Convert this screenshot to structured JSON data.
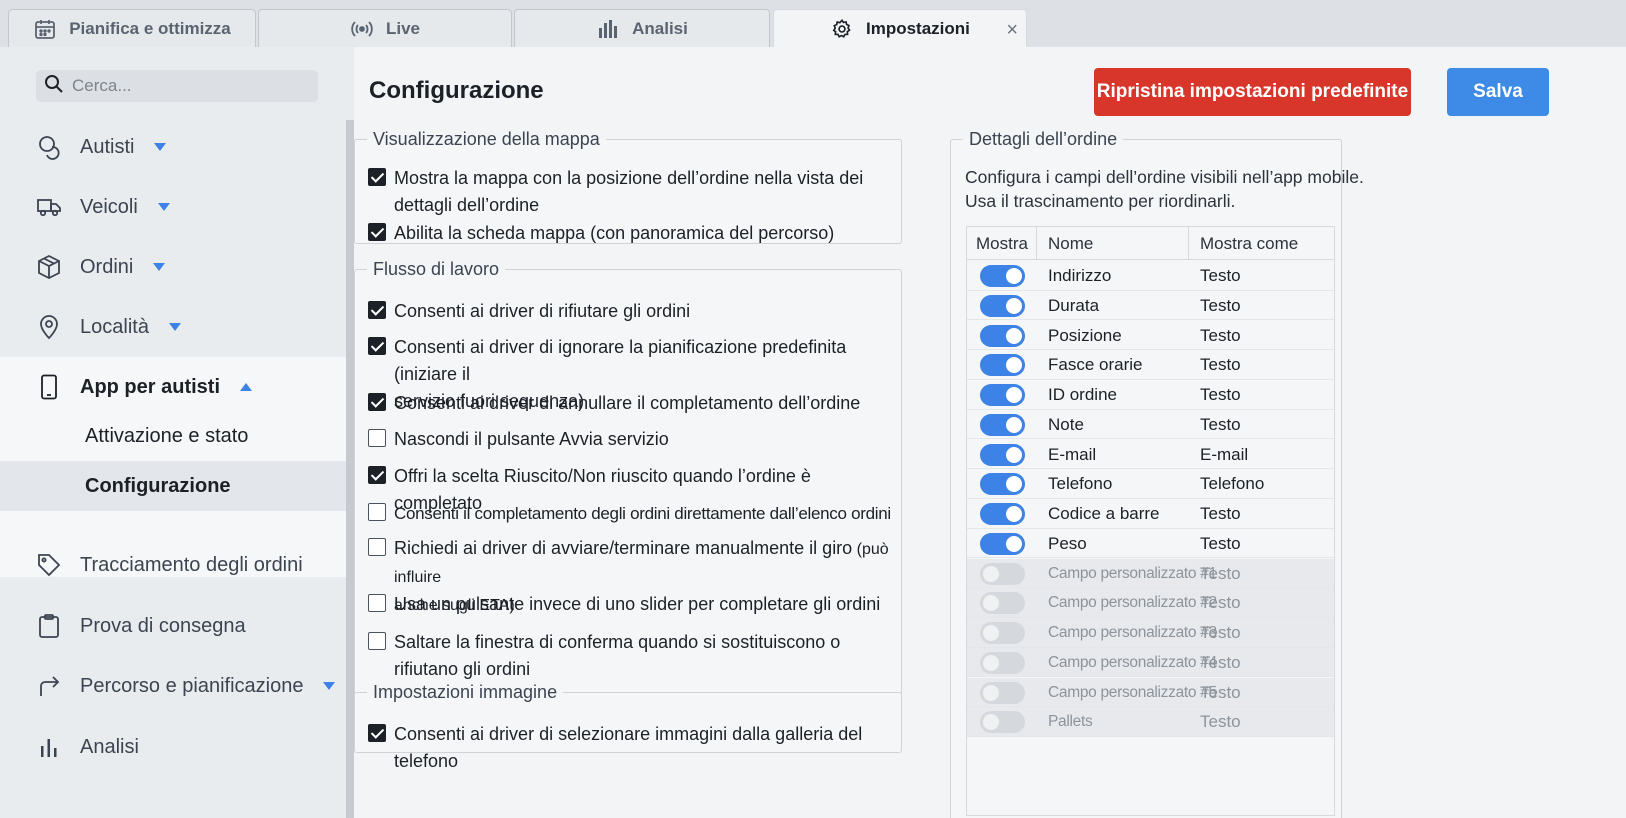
{
  "tabs": [
    {
      "label": "Pianifica e ottimizza",
      "icon": "calendar-icon"
    },
    {
      "label": "Live",
      "icon": "broadcast-icon"
    },
    {
      "label": "Analisi",
      "icon": "bar-chart-icon"
    },
    {
      "label": "Impostazioni",
      "icon": "gear-icon",
      "active": true
    }
  ],
  "tab_close": "×",
  "sidebar": {
    "search_placeholder": "Cerca...",
    "items": [
      {
        "label": "Autisti",
        "icon": "users-icon"
      },
      {
        "label": "Veicoli",
        "icon": "truck-icon"
      },
      {
        "label": "Ordini",
        "icon": "box-icon"
      },
      {
        "label": "Località",
        "icon": "location-pin-icon"
      },
      {
        "label": "App per autisti",
        "icon": "mobile-icon"
      },
      {
        "label": "Tracciamento degli ordini",
        "icon": "tag-icon"
      },
      {
        "label": "Prova di consegna",
        "icon": "clipboard-icon"
      },
      {
        "label": "Percorso e pianificazione",
        "icon": "route-arrow-icon"
      },
      {
        "label": "Analisi",
        "icon": "bar-chart-icon"
      }
    ],
    "sub_items": [
      "Attivazione e stato",
      "Configurazione"
    ]
  },
  "main": {
    "title": "Configurazione",
    "reset_label": "Ripristina impostazioni predefinite",
    "save_label": "Salva",
    "accent_color": "#3d82e6",
    "danger_color": "#d9362b"
  },
  "map_group": {
    "legend": "Visualizzazione della mappa",
    "options": [
      {
        "line1": "Mostra la mappa con la posizione dell’ordine nella vista dei",
        "line2": "dettagli dell’ordine",
        "checked": true
      },
      {
        "line1": "Abilita la scheda mappa (con panoramica del percorso)",
        "checked": true
      }
    ]
  },
  "workflow_group": {
    "legend": "Flusso di lavoro",
    "options": [
      {
        "line1": "Consenti ai driver di rifiutare gli ordini",
        "checked": true
      },
      {
        "line1": "Consenti ai driver di ignorare la pianificazione predefinita (iniziare il",
        "line2": "servizio fuori sequenza)",
        "checked": true
      },
      {
        "line1": "Consenti ai driver di annullare il completamento dell’ordine",
        "checked": true
      },
      {
        "line1": "Nascondi il pulsante Avvia servizio",
        "checked": false
      },
      {
        "line1": "Offri la scelta Riuscito/Non riuscito quando l’ordine è completato",
        "checked": true
      },
      {
        "line1": "Consenti il completamento degli ordini direttamente dall’elenco ordini",
        "checked": false
      },
      {
        "line1": "Richiedi ai driver di avviare/terminare manualmente il giro",
        "line1_small": " (può influire",
        "line2": "anche sugli ETA)",
        "checked": false
      },
      {
        "line1": "Usa un pulsante invece di uno slider per completare gli ordini",
        "checked": false
      },
      {
        "line1": "Saltare la finestra di conferma quando si sostituiscono o rifiutano gli ordini",
        "checked": false
      }
    ]
  },
  "image_group": {
    "legend": "Impostazioni immagine",
    "options": [
      {
        "line1": "Consenti ai driver di selezionare immagini dalla galleria del telefono",
        "checked": true
      }
    ]
  },
  "order_details": {
    "legend": "Dettagli dell’ordine",
    "desc1": "Configura i campi dell’ordine visibili nell’app mobile.",
    "desc2": "Usa il trascinamento per riordinarli.",
    "columns": [
      "Mostra",
      "Nome",
      "Mostra come"
    ],
    "rows": [
      {
        "name": "Indirizzo",
        "as": "Testo",
        "on": true
      },
      {
        "name": "Durata",
        "as": "Testo",
        "on": true
      },
      {
        "name": "Posizione",
        "as": "Testo",
        "on": true
      },
      {
        "name": "Fasce orarie",
        "as": "Testo",
        "on": true
      },
      {
        "name": "ID ordine",
        "as": "Testo",
        "on": true
      },
      {
        "name": "Note",
        "as": "Testo",
        "on": true
      },
      {
        "name": "E-mail",
        "as": "E-mail",
        "on": true
      },
      {
        "name": "Telefono",
        "as": "Telefono",
        "on": true
      },
      {
        "name": "Codice a barre",
        "as": "Testo",
        "on": true
      },
      {
        "name": "Peso",
        "as": "Testo",
        "on": true
      },
      {
        "name": "Campo personalizzato #1",
        "as": "Testo",
        "on": false
      },
      {
        "name": "Campo personalizzato #2",
        "as": "Testo",
        "on": false
      },
      {
        "name": "Campo personalizzato #3",
        "as": "Testo",
        "on": false
      },
      {
        "name": "Campo personalizzato #4",
        "as": "Testo",
        "on": false
      },
      {
        "name": "Campo personalizzato #5",
        "as": "Testo",
        "on": false
      },
      {
        "name": "Pallets",
        "as": "Testo",
        "on": false
      }
    ]
  }
}
